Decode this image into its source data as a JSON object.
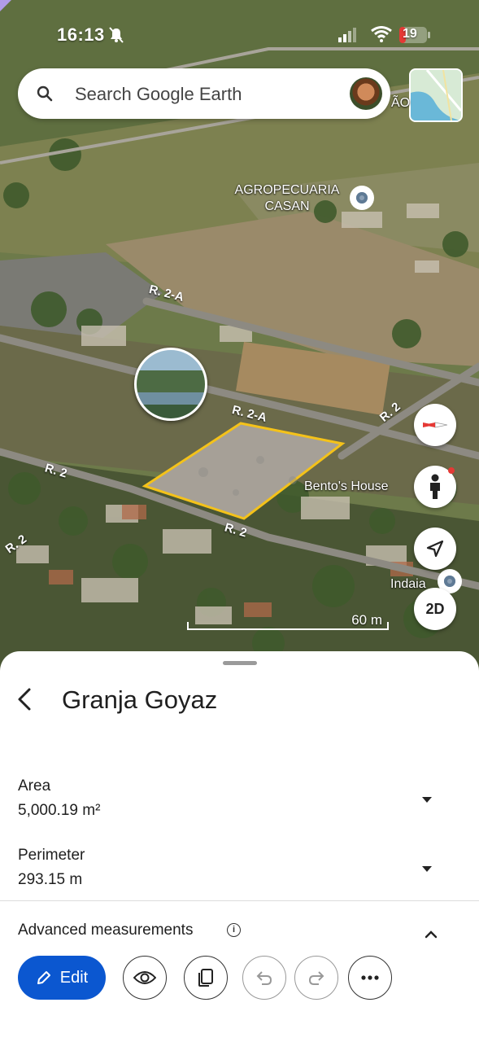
{
  "status_bar": {
    "time": "16:13",
    "battery": "19"
  },
  "search": {
    "placeholder": "Search Google Earth"
  },
  "map": {
    "labels": {
      "agro": "AGROPECUARIA CASAN",
      "bento": "Bento's House",
      "indaia": "Indaia",
      "edge_ao": "ÃO"
    },
    "roads": {
      "r2a_top": "R. 2-A",
      "r2a_mid": "R. 2-A",
      "r2_left": "R. 2",
      "r2_bottom": "R. 2",
      "r2_right": "R. 2",
      "r2_far_left": "R. 2"
    },
    "scale_label": "60 m",
    "view_mode_button": "2D",
    "polygon_color": "#f4c21a"
  },
  "sheet": {
    "title": "Granja Goyaz",
    "area": {
      "label": "Area",
      "value": "5,000.19 m²"
    },
    "perimeter": {
      "label": "Perimeter",
      "value": "293.15 m"
    },
    "advanced_label": "Advanced measurements",
    "edit_label": "Edit"
  },
  "icons": [
    "search-icon",
    "mute-icon",
    "signal-icon",
    "wifi-icon",
    "battery-icon",
    "compass-icon",
    "pegman-icon",
    "navigate-icon",
    "back-icon",
    "chevron-down-icon",
    "chevron-up-icon",
    "info-icon",
    "pencil-icon",
    "eye-icon",
    "copy-icon",
    "undo-icon",
    "redo-icon",
    "more-icon"
  ],
  "colors": {
    "accent": "#0b57d0",
    "compass_red": "#e53935"
  }
}
